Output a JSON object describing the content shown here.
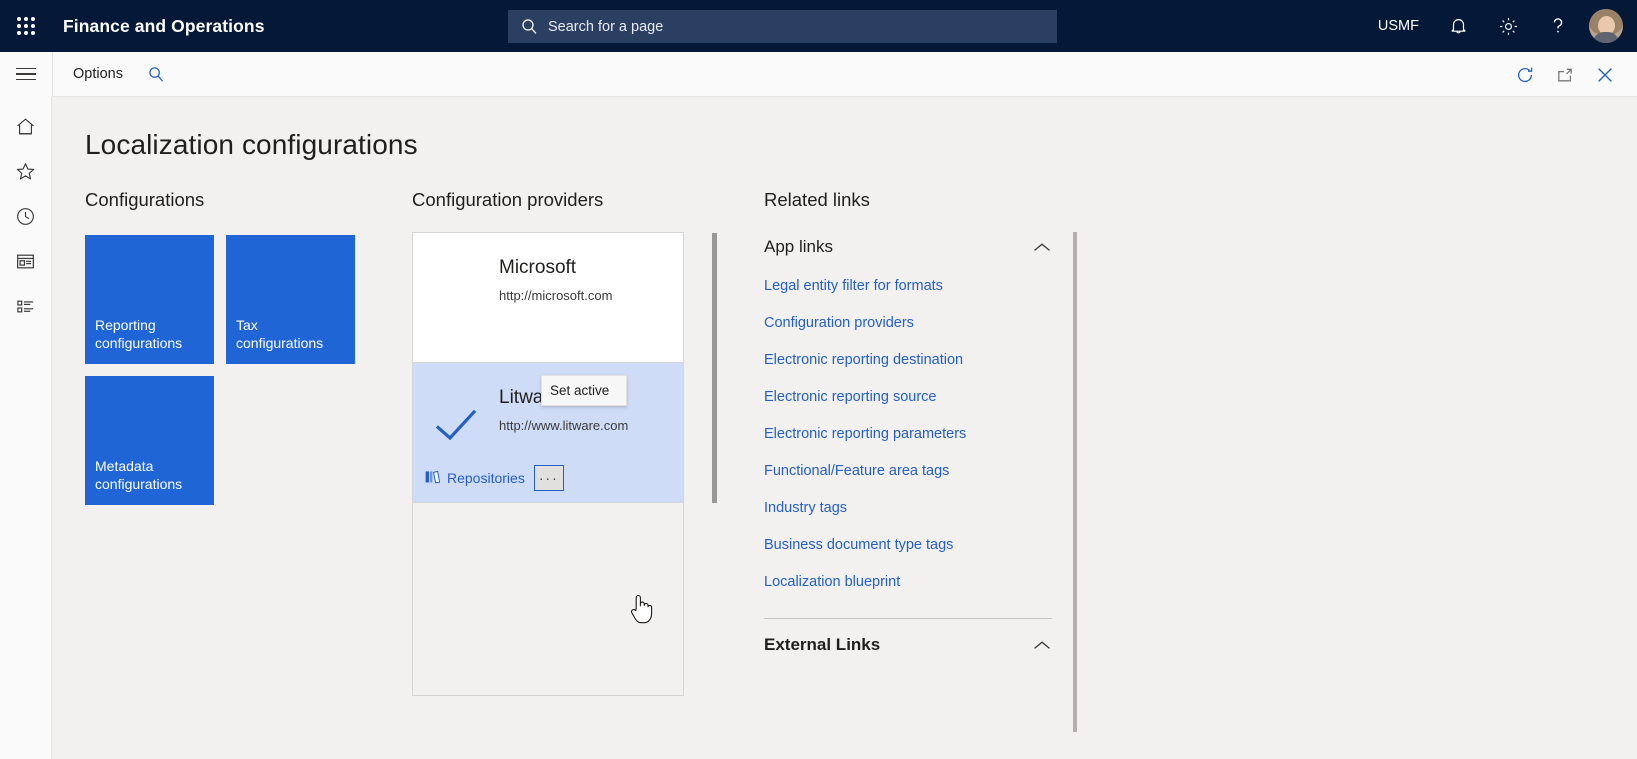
{
  "topbar": {
    "waffle_icon": "app-launcher-icon",
    "app_title": "Finance and Operations",
    "search": {
      "icon": "search-icon",
      "placeholder": "Search for a page",
      "value": ""
    },
    "company": "USMF",
    "icons": [
      {
        "name": "notifications-icon",
        "glyph": "bell"
      },
      {
        "name": "settings-icon",
        "glyph": "gear"
      },
      {
        "name": "help-icon",
        "glyph": "question"
      }
    ],
    "avatar_name": "user-avatar",
    "background_color": "#061838",
    "search_background": "#2b3f63"
  },
  "commandbar": {
    "hamburger_icon": "navigation-menu-icon",
    "options_label": "Options",
    "search_icon": "filter-search-icon",
    "right_icons": [
      {
        "name": "refresh-icon",
        "glyph": "refresh"
      },
      {
        "name": "open-in-new-window-icon",
        "glyph": "popout"
      },
      {
        "name": "close-icon",
        "glyph": "close"
      }
    ]
  },
  "rail": {
    "items": [
      {
        "name": "sidebar-item-home",
        "icon": "home-icon"
      },
      {
        "name": "sidebar-item-favorites",
        "icon": "star-icon"
      },
      {
        "name": "sidebar-item-recent",
        "icon": "clock-icon"
      },
      {
        "name": "sidebar-item-workspaces",
        "icon": "workspace-icon"
      },
      {
        "name": "sidebar-item-modules",
        "icon": "list-icon"
      }
    ]
  },
  "page": {
    "title": "Localization configurations",
    "accent_color": "#1f65d6",
    "link_color": "#2560c4"
  },
  "configurations": {
    "heading": "Configurations",
    "tiles": [
      {
        "label": "Reporting configurations"
      },
      {
        "label": "Tax configurations"
      },
      {
        "label": "Metadata configurations"
      }
    ]
  },
  "providers": {
    "heading": "Configuration providers",
    "items": [
      {
        "name": "Microsoft",
        "url": "http://microsoft.com",
        "selected": false
      },
      {
        "name": "Litware, Inc.",
        "url": "http://www.litware.com",
        "selected": true,
        "check_icon": "checkmark-icon",
        "repositories_label": "Repositories",
        "repositories_icon": "repositories-icon",
        "more_label": "···"
      }
    ],
    "context_menu": {
      "items": [
        {
          "label": "Set active"
        }
      ]
    }
  },
  "related_links": {
    "heading": "Related links",
    "groups": [
      {
        "title": "App links",
        "expanded": true,
        "chevron_icon": "chevron-up-icon",
        "links": [
          "Legal entity filter for formats",
          "Configuration providers",
          "Electronic reporting destination",
          "Electronic reporting source",
          "Electronic reporting parameters",
          "Functional/Feature area tags",
          "Industry tags",
          "Business document type tags",
          "Localization blueprint"
        ]
      },
      {
        "title": "External Links",
        "expanded": true,
        "chevron_icon": "chevron-up-icon",
        "links": []
      }
    ]
  },
  "cursor": {
    "name": "mouse-pointer-hand-icon"
  }
}
